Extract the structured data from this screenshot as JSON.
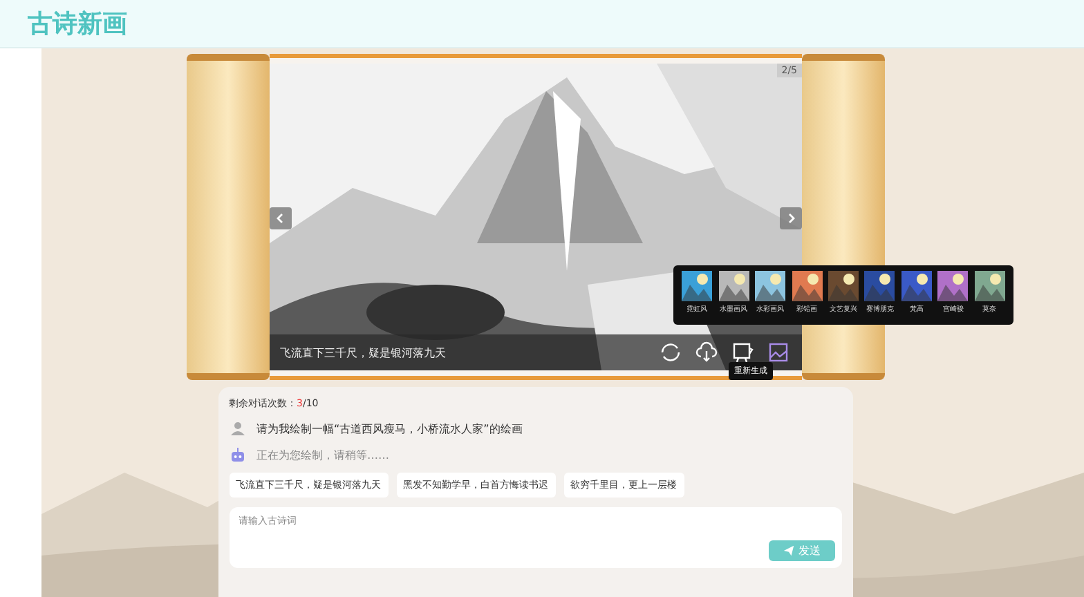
{
  "header": {
    "title": "古诗新画"
  },
  "scroll": {
    "counter": "2/5",
    "caption": "飞流直下三千尺，疑是银河落九天",
    "tooltip": "重新生成"
  },
  "styles": [
    {
      "label": "霓虹风"
    },
    {
      "label": "水墨画风"
    },
    {
      "label": "水彩画风"
    },
    {
      "label": "彩铅画"
    },
    {
      "label": "文艺复兴"
    },
    {
      "label": "赛博朋克"
    },
    {
      "label": "梵高"
    },
    {
      "label": "宫崎骏"
    },
    {
      "label": "莫奈"
    }
  ],
  "chat": {
    "remaining_label": "剩余对话次数：",
    "remaining_used": "3",
    "remaining_total": "/10",
    "messages": [
      {
        "kind": "user",
        "text": "请为我绘制一幅“古道西风瘦马，小桥流水人家”的绘画"
      },
      {
        "kind": "bot",
        "text": "正在为您绘制，请稍等……"
      }
    ],
    "suggestions": [
      "飞流直下三千尺，疑是银河落九天",
      "黑发不知勤学早，白首方悔读书迟",
      "欲穷千里目，更上一层楼"
    ],
    "input": {
      "placeholder": "请输入古诗词"
    },
    "send": "发送"
  }
}
